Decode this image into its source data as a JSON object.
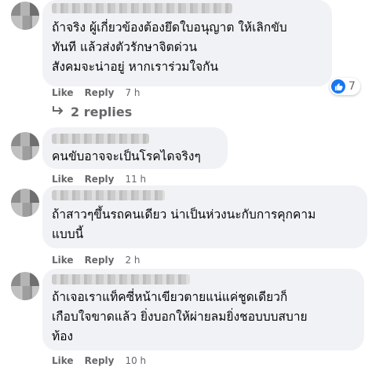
{
  "comments": [
    {
      "text": "ถ้าจริง ผู้เกี่ยวข้องต้องยึดใบอนุญาต ให้เลิกขับ\nทันที แล้วส่งตัวรักษาจิตด่วน\nสังคมจะน่าอยู่ หากเราร่วมใจกัน",
      "like": "Like",
      "reply": "Reply",
      "time": "7 h",
      "reaction_count": "7",
      "reaction_icon": "like-icon",
      "accent": "#1877f2"
    },
    {
      "text": "คนขับอาจจะเป็นโรคไดจริงๆ",
      "like": "Like",
      "reply": "Reply",
      "time": "11 h"
    },
    {
      "text": "ถ้าสาวๆขึ้นรถคนเดียว น่าเป็นห่วงนะกับการคุกคาม\nแบบนี้",
      "like": "Like",
      "reply": "Reply",
      "time": "2 h"
    },
    {
      "text": "ถ้าเจอเราแท็คซี่หน้าเขียวตายแน่แค่ชูดเดียวก็\nเกือบใจขาดแล้ว ยิ่งบอกให้ผ่ายลมยิ่งชอบบบสบาย\nท้อง",
      "like": "Like",
      "reply": "Reply",
      "time": "10 h"
    }
  ],
  "replies_link": {
    "icon": "reply-arrow-icon",
    "label": "2 replies"
  }
}
